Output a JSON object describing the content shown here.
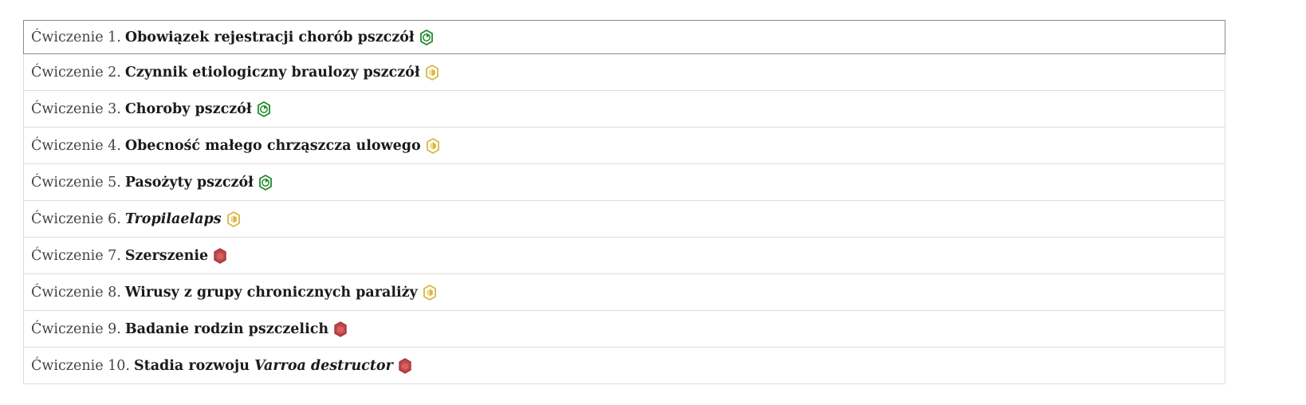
{
  "colors": {
    "done": "#1f8a2a",
    "partial": "#d8b744",
    "todo": "#c0464a"
  },
  "exercises": [
    {
      "prefix": "Ćwiczenie 1.",
      "title_before": "Obowiązek rejestracji chorób pszczół",
      "title_italic": "",
      "status": "done",
      "status_icon": "hexagon-play-icon"
    },
    {
      "prefix": "Ćwiczenie 2.",
      "title_before": "Czynnik etiologiczny braulozy pszczół",
      "title_italic": "",
      "status": "partial",
      "status_icon": "hexagon-half-icon"
    },
    {
      "prefix": "Ćwiczenie 3.",
      "title_before": "Choroby pszczół",
      "title_italic": "",
      "status": "done",
      "status_icon": "hexagon-play-icon"
    },
    {
      "prefix": "Ćwiczenie 4.",
      "title_before": "Obecność małego chrząszcza ulowego",
      "title_italic": "",
      "status": "partial",
      "status_icon": "hexagon-half-icon"
    },
    {
      "prefix": "Ćwiczenie 5.",
      "title_before": "Pasożyty pszczół",
      "title_italic": "",
      "status": "done",
      "status_icon": "hexagon-play-icon"
    },
    {
      "prefix": "Ćwiczenie 6.",
      "title_before": "",
      "title_italic": "Tropilaelaps",
      "status": "partial",
      "status_icon": "hexagon-half-icon"
    },
    {
      "prefix": "Ćwiczenie 7.",
      "title_before": "Szerszenie",
      "title_italic": "",
      "status": "todo",
      "status_icon": "hexagon-filled-icon"
    },
    {
      "prefix": "Ćwiczenie 8.",
      "title_before": "Wirusy z grupy chronicznych paraliży",
      "title_italic": "",
      "status": "partial",
      "status_icon": "hexagon-half-icon"
    },
    {
      "prefix": "Ćwiczenie 9.",
      "title_before": "Badanie rodzin pszczelich",
      "title_italic": "",
      "status": "todo",
      "status_icon": "hexagon-filled-icon"
    },
    {
      "prefix": "Ćwiczenie 10.",
      "title_before": "Stadia rozwoju ",
      "title_italic": "Varroa destructor",
      "status": "todo",
      "status_icon": "hexagon-filled-icon"
    }
  ]
}
